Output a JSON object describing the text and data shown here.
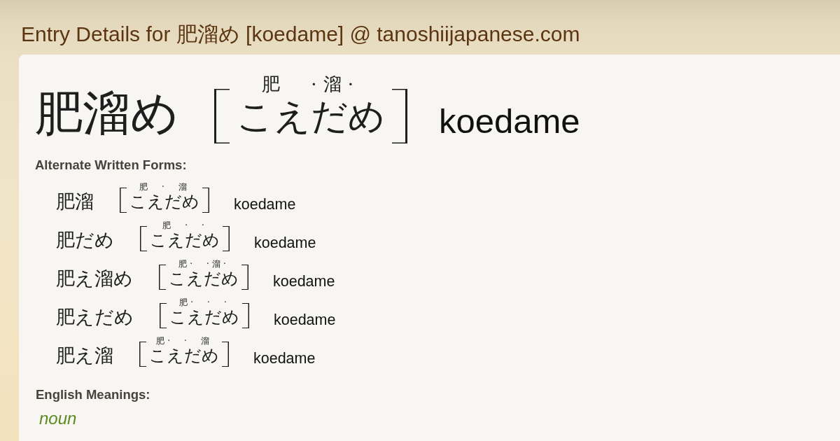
{
  "page_title": "Entry Details for 肥溜め [koedame] @ tanoshiijapanese.com",
  "entry": {
    "written": "肥溜め",
    "furigana": "肥　·溜·",
    "reading": "こえだめ",
    "romaji": "koedame"
  },
  "alternate_forms": {
    "heading": "Alternate Written Forms:",
    "items": [
      {
        "written": "肥溜",
        "furigana": "肥　·　溜",
        "reading": "こえだめ",
        "romaji": "koedame"
      },
      {
        "written": "肥だめ",
        "furigana": "肥　·　·",
        "reading": "こえだめ",
        "romaji": "koedame"
      },
      {
        "written": "肥え溜め",
        "furigana": "肥·　·溜·",
        "reading": "こえだめ",
        "romaji": "koedame"
      },
      {
        "written": "肥えだめ",
        "furigana": "肥·　·　·",
        "reading": "こえだめ",
        "romaji": "koedame"
      },
      {
        "written": "肥え溜",
        "furigana": "肥·　·　溜",
        "reading": "こえだめ",
        "romaji": "koedame"
      }
    ]
  },
  "meanings": {
    "heading": "English Meanings:",
    "part_of_speech": "noun"
  }
}
